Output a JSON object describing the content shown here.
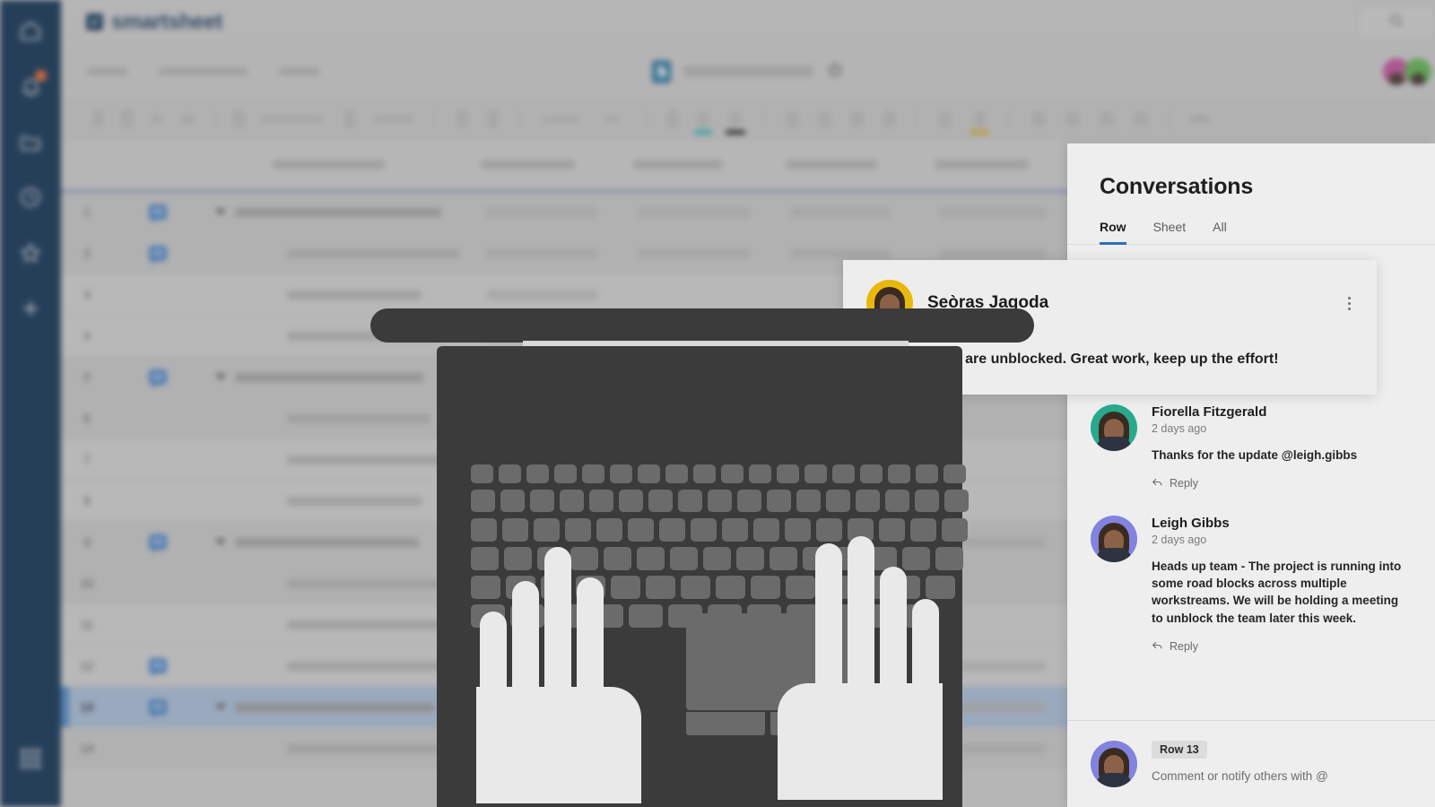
{
  "brand": {
    "name": "smartsheet",
    "logo_icon": "checkbox-icon"
  },
  "sidebar": {
    "items": [
      {
        "name": "home",
        "icon": "home-icon",
        "badge": null
      },
      {
        "name": "notifications",
        "icon": "bell-icon",
        "badge": "dot"
      },
      {
        "name": "browse",
        "icon": "folder-icon",
        "badge": null
      },
      {
        "name": "recents",
        "icon": "clock-icon",
        "badge": null
      },
      {
        "name": "favorites",
        "icon": "star-icon",
        "badge": null
      },
      {
        "name": "create",
        "icon": "plus-icon",
        "badge": null
      }
    ],
    "bottom_item": {
      "name": "app-switcher",
      "icon": "grid-icon"
    }
  },
  "topbar": {
    "search_icon": "search-icon"
  },
  "sheetbar": {
    "sheet_icon": "sheet-icon",
    "favorite_icon": "star-icon",
    "collaborators": [
      {
        "name": "collaborator-1",
        "color": "#c24a9b"
      },
      {
        "name": "collaborator-2",
        "color": "#5bb54a"
      }
    ]
  },
  "toolbar": {
    "overflow_label": "•••",
    "color_indicators": [
      {
        "name": "fill-color",
        "color": "#27b2c4"
      },
      {
        "name": "font-color",
        "color": "#1c1c1c"
      },
      {
        "name": "highlight-color",
        "color": "#d7a82a"
      }
    ]
  },
  "grid": {
    "rows": [
      {
        "num": "1",
        "has_comment": true,
        "is_parent": true,
        "selected": false
      },
      {
        "num": "2",
        "has_comment": true,
        "is_parent": false,
        "selected": false
      },
      {
        "num": "3",
        "has_comment": false,
        "is_parent": false,
        "selected": false
      },
      {
        "num": "4",
        "has_comment": false,
        "is_parent": false,
        "selected": false
      },
      {
        "num": "5",
        "has_comment": true,
        "is_parent": true,
        "selected": false
      },
      {
        "num": "6",
        "has_comment": false,
        "is_parent": false,
        "selected": false
      },
      {
        "num": "7",
        "has_comment": false,
        "is_parent": false,
        "selected": false
      },
      {
        "num": "8",
        "has_comment": false,
        "is_parent": false,
        "selected": false
      },
      {
        "num": "9",
        "has_comment": true,
        "is_parent": true,
        "selected": false
      },
      {
        "num": "10",
        "has_comment": false,
        "is_parent": false,
        "selected": false
      },
      {
        "num": "11",
        "has_comment": false,
        "is_parent": false,
        "selected": false
      },
      {
        "num": "12",
        "has_comment": true,
        "is_parent": false,
        "selected": false
      },
      {
        "num": "13",
        "has_comment": true,
        "is_parent": true,
        "selected": true
      },
      {
        "num": "14",
        "has_comment": false,
        "is_parent": false,
        "selected": false
      }
    ]
  },
  "conversations": {
    "title": "Conversations",
    "tabs": [
      {
        "label": "Row",
        "active": true
      },
      {
        "label": "Sheet",
        "active": false
      },
      {
        "label": "All",
        "active": false
      }
    ],
    "featured_comment": {
      "author": "Seòras Jagoda",
      "text": "We are unblocked. Great work, keep up the effort!",
      "avatar_color": "#e8b80c",
      "menu_icon": "kebab-menu-icon"
    },
    "comments": [
      {
        "author": "Fiorella Fitzgerald",
        "time": "2 days ago",
        "text": "Thanks for the update @leigh.gibbs",
        "reply_label": "Reply",
        "avatar_color": "#29a98c"
      },
      {
        "author": "Leigh Gibbs",
        "time": "2 days ago",
        "text": "Heads up team - The project is running into some road blocks across multiple workstreams. We will be holding a meeting to unblock the team later this week.",
        "reply_label": "Reply",
        "avatar_color": "#8183de"
      }
    ],
    "composer": {
      "row_badge": "Row 13",
      "placeholder": "Comment or notify others with @",
      "avatar_color": "#8183de"
    }
  },
  "illustration": {
    "name": "laptop-with-hands",
    "laptop_color": "#3b3b3b",
    "key_color": "#6b6b6b",
    "hand_color": "#e9e9e9"
  }
}
